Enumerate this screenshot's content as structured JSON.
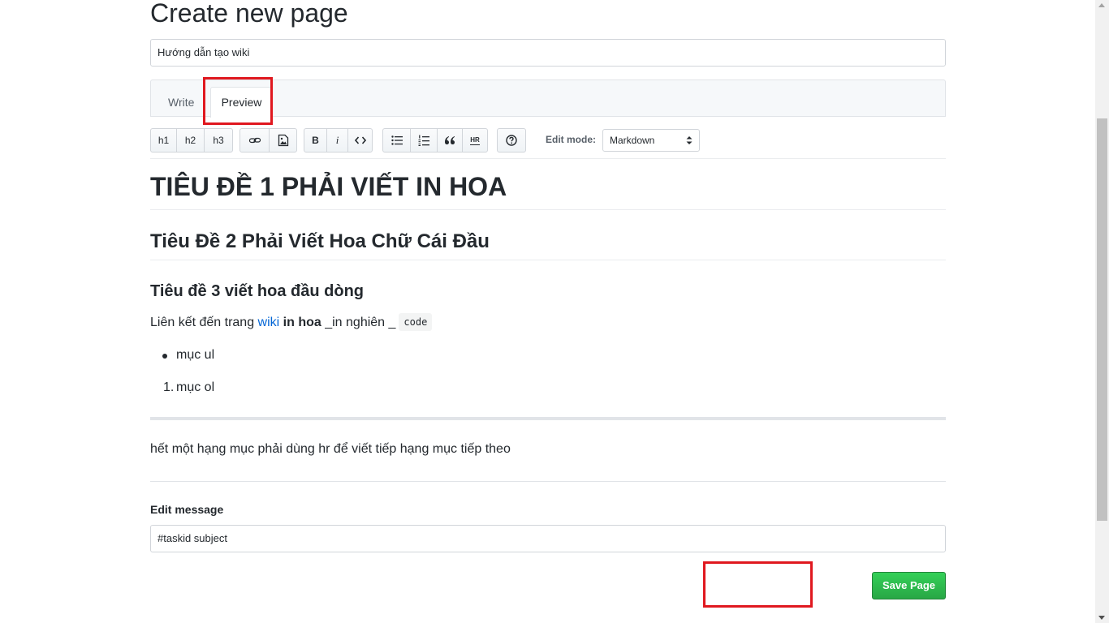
{
  "page": {
    "title": "Create new page",
    "page_name_value": "Hướng dẫn tạo wiki"
  },
  "tabs": [
    {
      "label": "Write",
      "active": false
    },
    {
      "label": "Preview",
      "active": true
    }
  ],
  "toolbar": {
    "h1": "h1",
    "h2": "h2",
    "h3": "h3",
    "bold": "B",
    "italic": "i",
    "hr": "HR",
    "edit_mode_label": "Edit mode:",
    "edit_mode_value": "Markdown"
  },
  "preview": {
    "h1": "TIÊU ĐỀ 1 PHẢI VIẾT IN HOA",
    "h2": "Tiêu Đề 2 Phải Viết Hoa Chữ Cái Đầu",
    "h3": "Tiêu đề 3 viết hoa đầu dòng",
    "para_prefix": "Liên kết đến trang ",
    "para_link": "wiki",
    "para_bold": "in hoa",
    "para_italic": " _in nghiên _",
    "para_code": "code",
    "ul_item": "mục ul",
    "ol_number": "1.",
    "ol_item": "mục ol",
    "after_hr": "hết một hạng mục phải dùng hr để viết tiếp hạng mục tiếp theo"
  },
  "edit_message": {
    "label": "Edit message",
    "value": "#taskid subject"
  },
  "save_button": "Save Page",
  "colors": {
    "save_green": "#28a745",
    "highlight_red": "#e0181f",
    "link_blue": "#0366d6"
  }
}
